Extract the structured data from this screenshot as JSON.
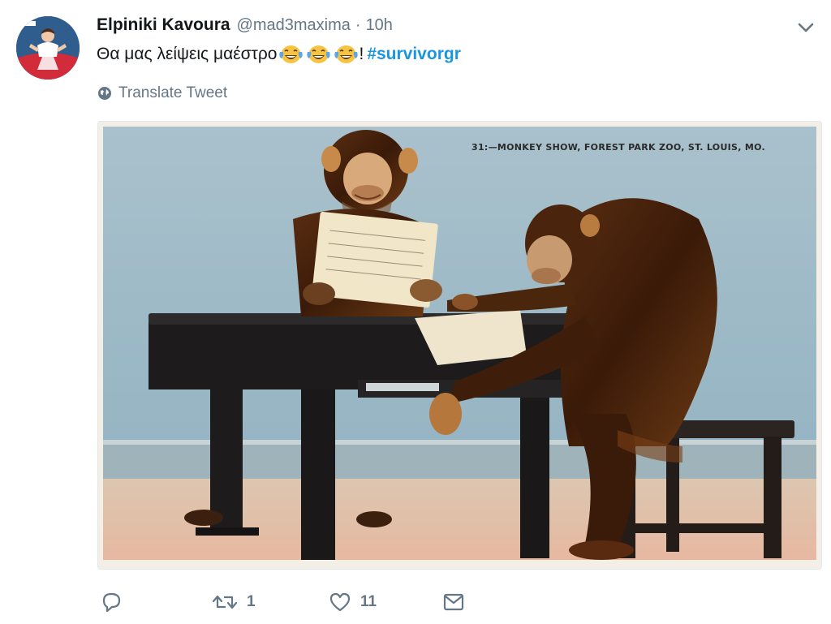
{
  "tweet": {
    "author_name": "Elpiniki Kavoura",
    "handle": "@mad3maxima",
    "separator": "·",
    "time": "10h",
    "text": "Θα μας λείψεις μαέστρο",
    "exclamation": "!",
    "hashtag": "#survivorgr",
    "translate_label": "Translate Tweet",
    "image_caption": "31:—MONKEY SHOW, FOREST PARK ZOO, ST. LOUIS, MO."
  },
  "actions": {
    "retweet_count": "1",
    "like_count": "11"
  },
  "icons": {
    "reply": "reply-icon",
    "retweet": "retweet-icon",
    "like": "heart-icon",
    "dm": "envelope-icon",
    "more": "chevron-down-icon",
    "translate": "globe-icon"
  },
  "colors": {
    "link": "#1b95e0",
    "secondary": "#657786",
    "text": "#14171a"
  }
}
